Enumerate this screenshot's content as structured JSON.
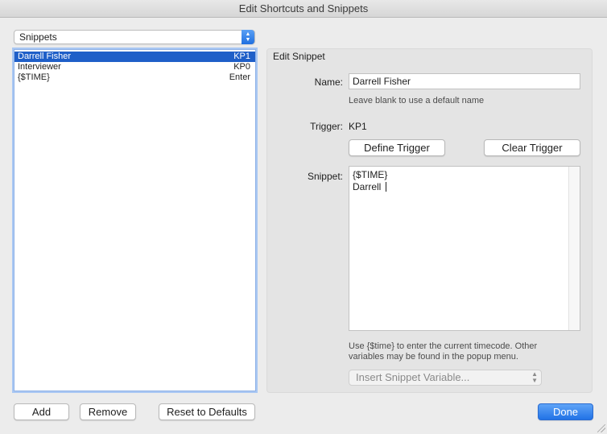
{
  "window": {
    "title": "Edit Shortcuts and Snippets"
  },
  "mode_popup": {
    "selected": "Snippets"
  },
  "snippets_list": {
    "rows": [
      {
        "name": "Darrell Fisher",
        "key": "KP1",
        "selected": true
      },
      {
        "name": "Interviewer",
        "key": "KP0",
        "selected": false
      },
      {
        "name": "{$TIME}",
        "key": "Enter",
        "selected": false
      }
    ]
  },
  "list_buttons": {
    "add": "Add",
    "remove": "Remove",
    "reset": "Reset to Defaults"
  },
  "edit": {
    "title": "Edit Snippet",
    "name_label": "Name:",
    "name_value": "Darrell Fisher",
    "name_hint": "Leave blank to use a default name",
    "trigger_label": "Trigger:",
    "trigger_value": "KP1",
    "define_trigger": "Define Trigger",
    "clear_trigger": "Clear Trigger",
    "snippet_label": "Snippet:",
    "snippet_lines": [
      "{$TIME}",
      "Darrell "
    ],
    "snippet_hint_1": "Use {$time} to enter the current timecode. Other",
    "snippet_hint_2": "variables may be found in the popup menu.",
    "variable_popup": "Insert Snippet Variable..."
  },
  "done": "Done",
  "colors": {
    "accent": "#2172e6",
    "selection": "#1f5fc8"
  },
  "icons": {
    "stepper": "updown-chevron-icon",
    "resize": "resize-grip-icon"
  }
}
